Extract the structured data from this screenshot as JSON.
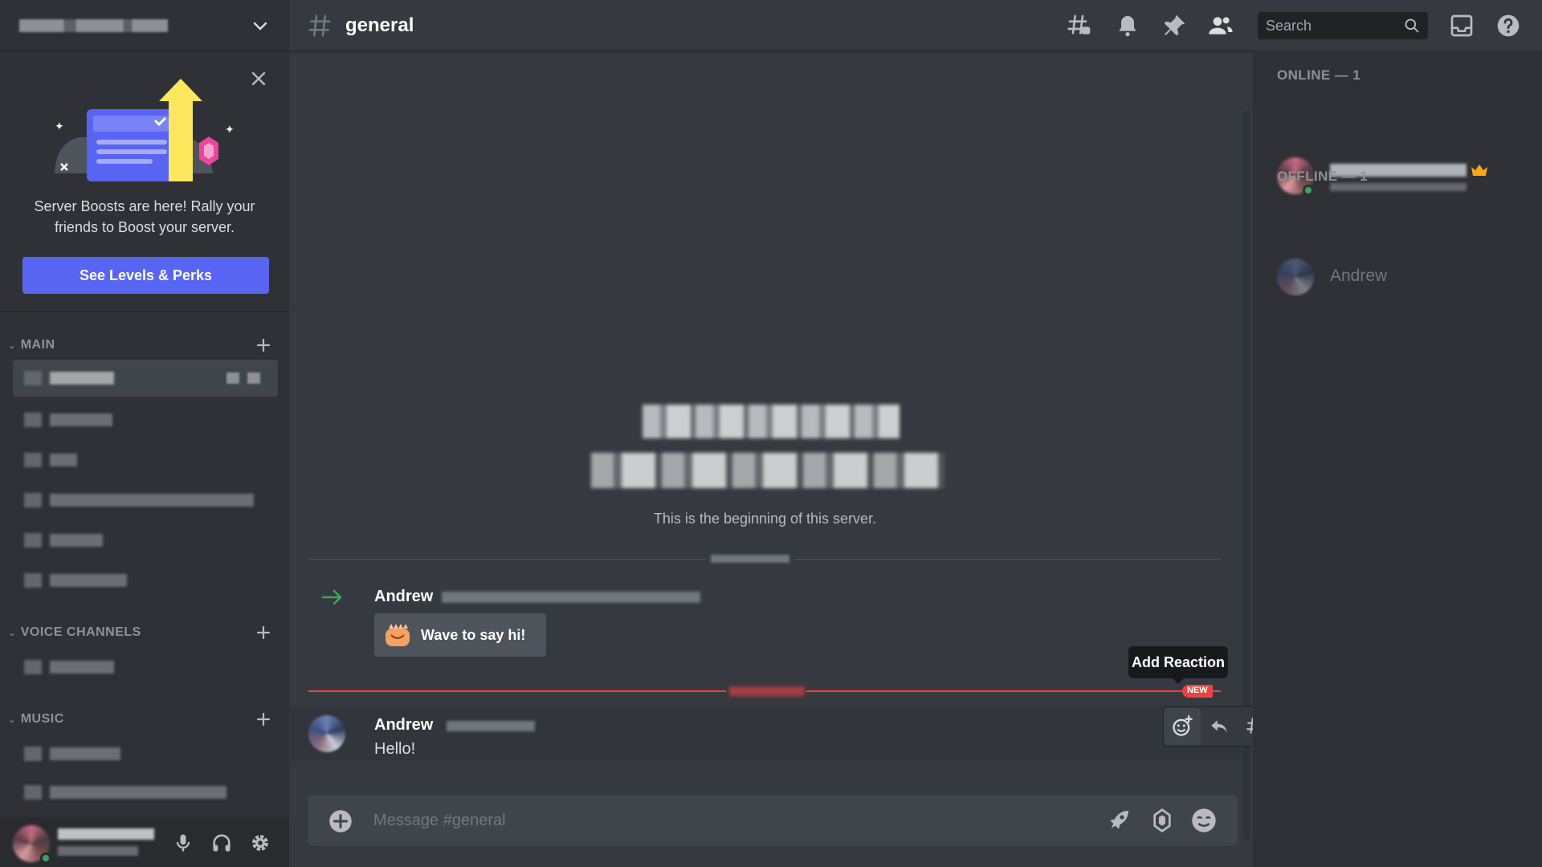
{
  "channel": {
    "name": "general",
    "composer_placeholder": "Message #general"
  },
  "search": {
    "placeholder": "Search"
  },
  "boost_card": {
    "text": "Server Boosts are here! Rally your friends to Boost your server.",
    "button_label": "See Levels & Perks"
  },
  "sidebar": {
    "categories": [
      {
        "label": "MAIN"
      },
      {
        "label": "VOICE CHANNELS"
      },
      {
        "label": "MUSIC"
      }
    ]
  },
  "welcome": {
    "text": "This is the beginning of this server."
  },
  "messages": {
    "join": {
      "author": "Andrew",
      "wave_label": "Wave to say hi!"
    },
    "new_badge": "NEW",
    "latest": {
      "author": "Andrew",
      "body": "Hello!"
    }
  },
  "tooltip": {
    "label": "Add Reaction"
  },
  "members": {
    "online_header": "ONLINE — 1",
    "offline_header": "OFFLINE — 1",
    "offline_name": "Andrew"
  },
  "colors": {
    "blurple": "#5865f2",
    "online_green": "#3ba55d",
    "new_red": "#ed4245",
    "crown": "#faa61a"
  },
  "icons": [
    "chevron-down-icon",
    "close-icon",
    "hash-icon",
    "threads-icon",
    "bell-icon",
    "pin-icon",
    "members-icon",
    "search-icon",
    "inbox-icon",
    "help-icon",
    "plus-icon",
    "mic-icon",
    "headphones-icon",
    "settings-icon",
    "add-reaction-icon",
    "reply-icon",
    "thread-icon",
    "more-icon",
    "join-arrow-icon",
    "nitro-rocket-icon",
    "boost-gem-icon",
    "emoji-icon",
    "crown-icon",
    "wave-sticker-icon"
  ]
}
